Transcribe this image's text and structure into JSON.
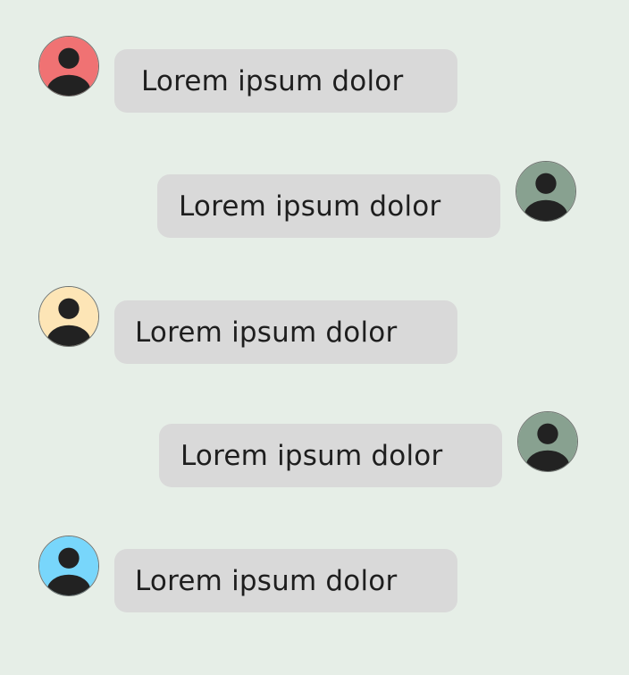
{
  "messages": [
    {
      "text": "Lorem ipsum dolor",
      "avatar_color": "#f07273"
    },
    {
      "text": "Lorem ipsum dolor",
      "avatar_color": "#88a190"
    },
    {
      "text": "Lorem ipsum dolor",
      "avatar_color": "#fde5b6"
    },
    {
      "text": "Lorem ipsum dolor",
      "avatar_color": "#88a190"
    },
    {
      "text": "Lorem ipsum dolor",
      "avatar_color": "#78d6fb"
    }
  ]
}
